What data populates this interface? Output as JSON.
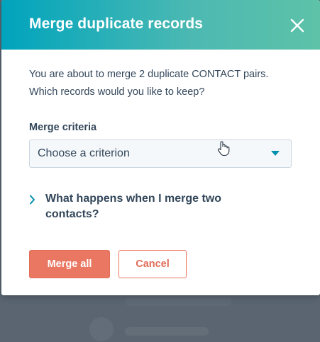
{
  "modal": {
    "title": "Merge duplicate records",
    "intro_line1": "You are about to merge 2 duplicate CONTACT pairs.",
    "intro_line2": "Which records would you like to keep?"
  },
  "form": {
    "criteria_label": "Merge criteria",
    "criteria_selected": "Choose a criterion"
  },
  "accordion": {
    "label": "What happens when I merge two contacts?"
  },
  "buttons": {
    "merge_all": "Merge all",
    "cancel": "Cancel"
  },
  "icons": {
    "close": "close-icon",
    "select_caret": "caret-down-icon",
    "accordion": "chevron-right-icon",
    "cursor": "hand-pointer-cursor"
  },
  "colors": {
    "header_gradient_start": "#00a4bd",
    "header_gradient_end": "#5ec2a8",
    "primary_button": "#ea7762",
    "text": "#33475b",
    "caret": "#0091ae"
  }
}
